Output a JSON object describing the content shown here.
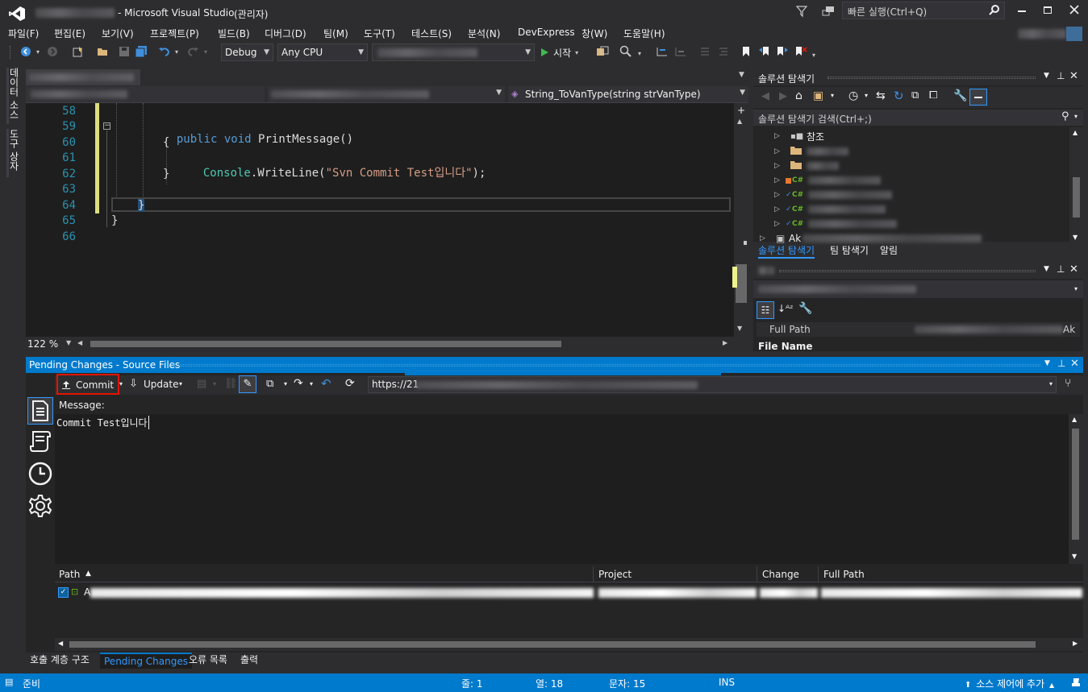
{
  "title_bar": {
    "app_title": "- Microsoft Visual Studio",
    "admin": "(관리자)",
    "quick_launch_placeholder": "빠른 실행(Ctrl+Q)"
  },
  "menu": [
    "파일(F)",
    "편집(E)",
    "보기(V)",
    "프로젝트(P)",
    "빌드(B)",
    "디버그(D)",
    "팀(M)",
    "도구(T)",
    "테스트(S)",
    "분석(N)",
    "DevExpress",
    "창(W)",
    "도움말(H)"
  ],
  "toolbar": {
    "config": "Debug",
    "platform": "Any CPU",
    "start_label": "시작"
  },
  "left_rail": {
    "data_sources": "데이터 소스",
    "toolbox": "도구 상자"
  },
  "editor": {
    "member_dropdown": "String_ToVanType(string strVanType)",
    "zoom": "122 %",
    "lines": [
      {
        "num": "58",
        "text": ""
      },
      {
        "num": "59",
        "text": "public void PrintMessage()"
      },
      {
        "num": "60",
        "text": "{"
      },
      {
        "num": "61",
        "text": "Console.WriteLine(\"Svn Commit Test입니다\");"
      },
      {
        "num": "62",
        "text": "}"
      },
      {
        "num": "63",
        "text": ""
      },
      {
        "num": "64",
        "text": "}"
      },
      {
        "num": "65",
        "text": "}"
      },
      {
        "num": "66",
        "text": ""
      }
    ],
    "kw_public": "public",
    "kw_void": "void",
    "method": "PrintMessage()",
    "console": "Console",
    "writeline": ".WriteLine(",
    "string_lit": "\"Svn Commit Test입니다\"",
    "end_stmt": ");"
  },
  "solution_explorer": {
    "title": "솔루션 탐색기",
    "search_placeholder": "솔루션 탐색기 검색(Ctrl+;)",
    "references": "참조",
    "project_prefix": "Ak",
    "tabs": [
      "솔루션 탐색기",
      "팀 탐색기",
      "알림"
    ]
  },
  "properties": {
    "row_label": "Full Path",
    "row_value_suffix": "Ak",
    "section": "File Name"
  },
  "pending_changes": {
    "title": "Pending Changes - Source Files",
    "commit_label": "Commit",
    "update_label": "Update",
    "url_prefix": "https://21",
    "message_label": "Message:",
    "message_value": "Commit Test입니다",
    "columns": [
      "Path",
      "Project",
      "Change",
      "Full Path"
    ],
    "row_prefix": "A"
  },
  "bottom_tabs": [
    "호출 계층 구조",
    "Pending Changes",
    "오류 목록",
    "출력"
  ],
  "status_bar": {
    "ready": "준비",
    "line": "줄: 1",
    "col": "열: 18",
    "char": "문자: 15",
    "mode": "INS",
    "source_control": "소스 제어에 추가"
  },
  "colors": {
    "accent": "#007acc",
    "commit_highlight": "#e51400",
    "keyword": "#569cd6",
    "string": "#d69d85",
    "type": "#4ec9b0"
  }
}
